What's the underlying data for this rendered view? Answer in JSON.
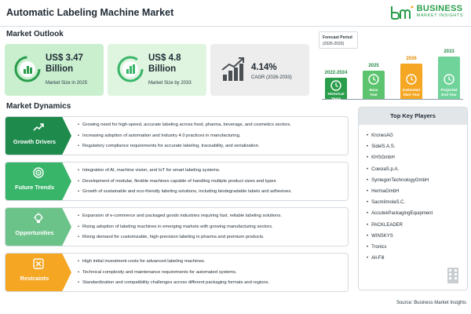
{
  "header": {
    "title": "Automatic Labeling Machine Market",
    "logo_line1": "BUSINESS",
    "logo_line2": "MARKET INSIGHTS",
    "logo_mark": "bmi"
  },
  "outlook": {
    "title": "Market Outlook",
    "stats": [
      {
        "value": "US$ 3.47",
        "value2": "Billion",
        "label": "Market Size in 2025",
        "icon": "chart-circle-icon"
      },
      {
        "value": "US$ 4.8",
        "value2": "Billion",
        "label": "Market Size by 2033",
        "icon": "chart-circle-icon"
      },
      {
        "value": "4.14%",
        "label": "CAGR (2026-2033)",
        "icon": "trend-up-icon"
      }
    ]
  },
  "timeline": {
    "forecast_label": "Forecast Period",
    "forecast_range": "(2026-2033)",
    "bars": [
      {
        "year": "2022-2024",
        "caption_l1": "Historical",
        "caption_l2": "Years",
        "color": "#2a9d4b",
        "level": 0.45
      },
      {
        "year": "2025",
        "caption_l1": "Base",
        "caption_l2": "Year",
        "color": "#5cc46f",
        "level": 0.6
      },
      {
        "year": "2026",
        "caption_l1": "Estimated",
        "caption_l2": "Start Year",
        "color": "#f5a623",
        "level": 0.75
      },
      {
        "year": "2033",
        "caption_l1": "Projected",
        "caption_l2": "End Year",
        "color": "#6fd39a",
        "level": 0.9
      }
    ]
  },
  "dynamics": {
    "title": "Market Dynamics",
    "blocks": [
      {
        "label": "Growth Drivers",
        "color": "#1e8a4c",
        "icon": "trend-icon",
        "points": [
          "Growing need for high-speed, accurate labeling across food, pharma, beverage, and cosmetics sectors.",
          "Increasing adoption of automation and Industry 4.0 practices in manufacturing.",
          "Regulatory compliance requirements for accurate labeling, traceability, and serialization."
        ]
      },
      {
        "label": "Future Trends",
        "color": "#39b56a",
        "icon": "target-icon",
        "points": [
          "Integration of AI, machine vision, and IoT for smart labeling systems.",
          "Development of modular, flexible machines capable of handling multiple product sizes and types",
          "Growth of sustainable and eco-friendly labeling solutions, including biodegradable labels and adhesives."
        ]
      },
      {
        "label": "Opportunities",
        "color": "#6cc38a",
        "icon": "lightbulb-icon",
        "points": [
          "Expansion of e-commerce and packaged goods industries requiring fast, reliable labeling solutions.",
          "Rising adoption of labeling machines in emerging markets with growing manufacturing sectors.",
          "Rising demand for customizable, high-precision labeling in pharma and premium products."
        ]
      },
      {
        "label": "Restraints",
        "color": "#f5a623",
        "icon": "restraint-icon",
        "points": [
          "High initial investment costs for advanced labeling machines.",
          "Technical complexity and maintenance requirements for automated systems.",
          "Standardization and compatibility challenges across different packaging formats and regions."
        ]
      }
    ]
  },
  "players": {
    "title": "Top Key Players",
    "items": [
      "KronesAG",
      "SidelS.A.S.",
      "KHSGmbH",
      "CoesiaS.p.A.",
      "SyntegonTechnologyGmbH",
      "HermaGmbH",
      "SacmiImolaS.C.",
      "AccutekPackagingEquipment",
      "PACKLEADER",
      "WINSKYS",
      "Tronics",
      "All-Fill"
    ]
  },
  "footer": {
    "source": "Source: Business Market Insights"
  }
}
